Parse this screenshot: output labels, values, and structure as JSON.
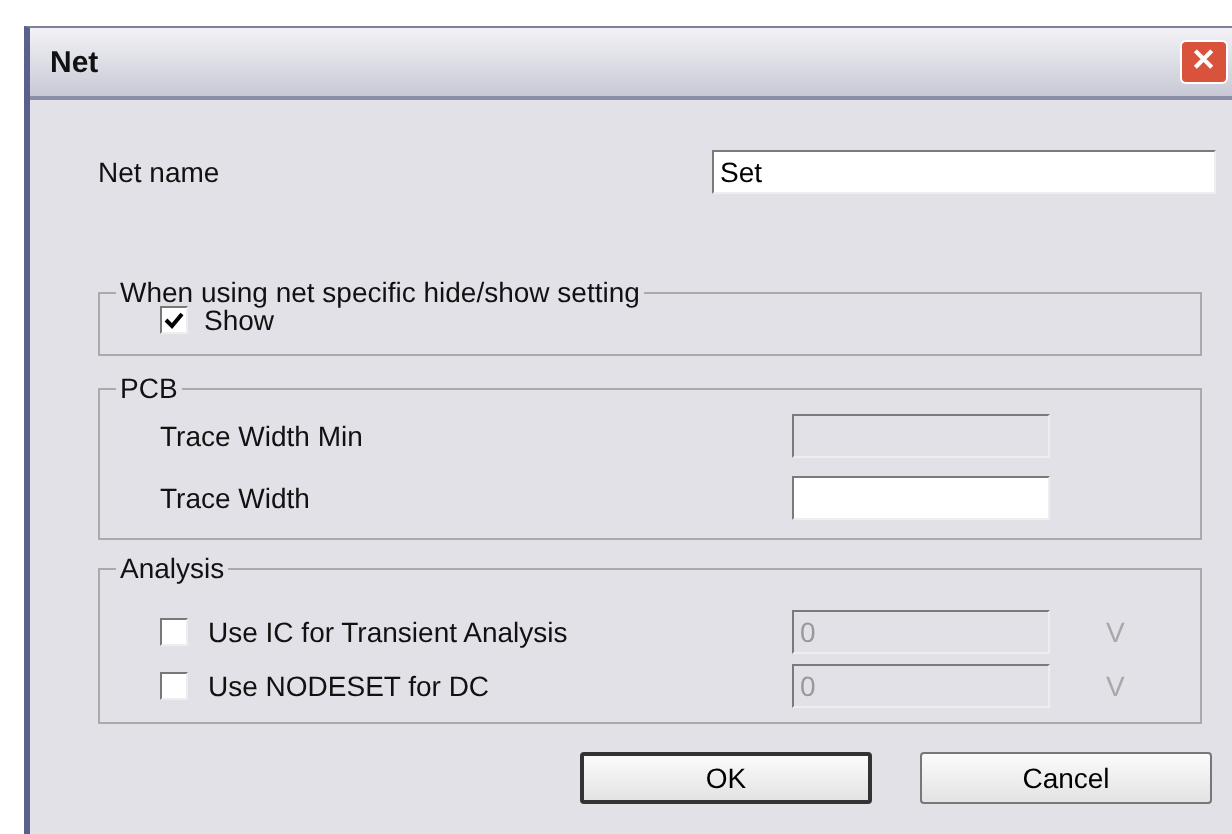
{
  "window": {
    "title": "Net",
    "close": "✕"
  },
  "net_name": {
    "label": "Net name",
    "value": "Set"
  },
  "display_group": {
    "title": "When using net specific hide/show setting",
    "checkbox": {
      "label": "Show",
      "checked": true
    }
  },
  "pcb_group": {
    "title": "PCB",
    "fields": [
      {
        "label": "Trace Width Min",
        "disabled": true
      },
      {
        "label": "Trace Width",
        "disabled": false
      }
    ]
  },
  "analysis_group": {
    "title": "Analysis",
    "rows": [
      {
        "label": "Use IC for Transient Analysis",
        "checked": false,
        "value": "0",
        "unit": "V",
        "disabled": true
      },
      {
        "label": "Use NODESET for DC",
        "checked": false,
        "value": "0",
        "unit": "V",
        "disabled": true
      }
    ]
  },
  "buttons": [
    {
      "label": "OK",
      "default": true
    },
    {
      "label": "Cancel",
      "default": false
    }
  ]
}
